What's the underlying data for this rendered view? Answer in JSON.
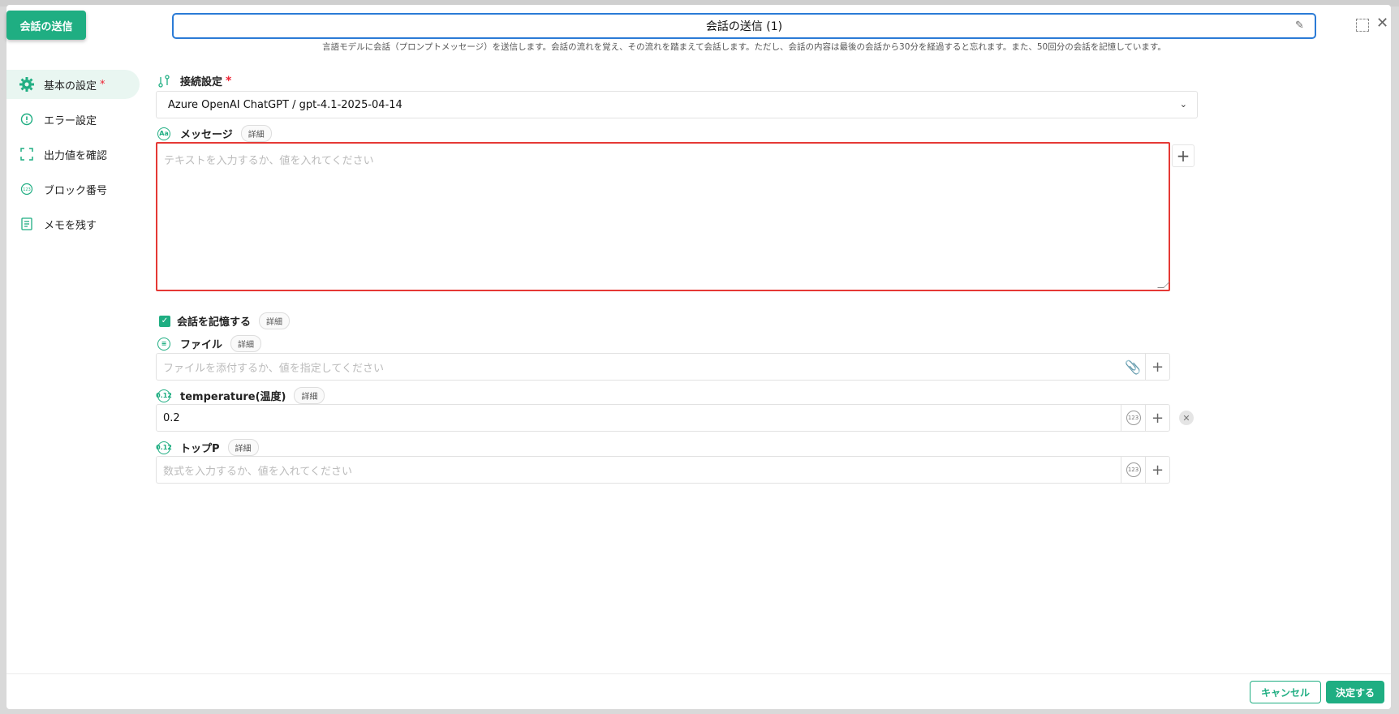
{
  "block_tag": "会話の送信",
  "title": "会話の送信 (1)",
  "description": "言語モデルに会話（プロンプトメッセージ）を送信します。会話の流れを覚え、その流れを踏まえて会話します。ただし、会話の内容は最後の会話から30分を経過すると忘れます。また、50回分の会話を記憶しています。",
  "sidebar": {
    "items": [
      {
        "label": "基本の設定",
        "required": "*"
      },
      {
        "label": "エラー設定"
      },
      {
        "label": "出力値を確認"
      },
      {
        "label": "ブロック番号"
      },
      {
        "label": "メモを残す"
      }
    ]
  },
  "form": {
    "connection": {
      "label": "接続設定",
      "required": "*",
      "value": "Azure OpenAI ChatGPT / gpt-4.1-2025-04-14"
    },
    "message": {
      "label": "メッセージ",
      "detail": "詳細",
      "placeholder": "テキストを入力するか、値を入れてください"
    },
    "remember": {
      "label": "会話を記憶する",
      "detail": "詳細",
      "checked": true
    },
    "file": {
      "label": "ファイル",
      "detail": "詳細",
      "placeholder": "ファイルを添付するか、値を指定してください"
    },
    "temperature": {
      "label": "temperature(温度)",
      "detail": "詳細",
      "value": "0.2"
    },
    "top_p": {
      "label": "トップP",
      "detail": "詳細",
      "placeholder": "数式を入力するか、値を入れてください"
    }
  },
  "footer": {
    "cancel": "キャンセル",
    "ok": "決定する"
  },
  "colors": {
    "accent": "#1fae82",
    "error_border": "#e53935",
    "title_border": "#2b7bd6"
  }
}
